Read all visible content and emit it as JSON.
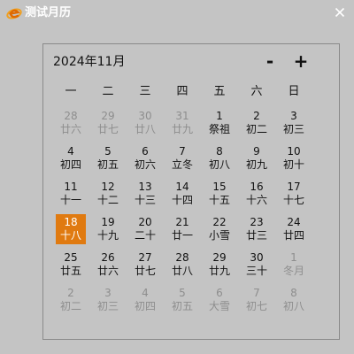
{
  "window": {
    "title": "测试月历",
    "close_icon": "close-icon",
    "logo_icon": "app-logo-icon"
  },
  "calendar": {
    "month_label": "2024年11月",
    "prev_label": "-",
    "next_label": "+",
    "weekdays": [
      "一",
      "二",
      "三",
      "四",
      "五",
      "六",
      "日"
    ],
    "selected_color": "#e07a10",
    "weeks": [
      [
        {
          "day": "28",
          "lunar": "廿六",
          "current": false
        },
        {
          "day": "29",
          "lunar": "廿七",
          "current": false
        },
        {
          "day": "30",
          "lunar": "廿八",
          "current": false
        },
        {
          "day": "31",
          "lunar": "廿九",
          "current": false
        },
        {
          "day": "1",
          "lunar": "祭祖",
          "current": true
        },
        {
          "day": "2",
          "lunar": "初二",
          "current": true
        },
        {
          "day": "3",
          "lunar": "初三",
          "current": true
        }
      ],
      [
        {
          "day": "4",
          "lunar": "初四",
          "current": true
        },
        {
          "day": "5",
          "lunar": "初五",
          "current": true
        },
        {
          "day": "6",
          "lunar": "初六",
          "current": true
        },
        {
          "day": "7",
          "lunar": "立冬",
          "current": true
        },
        {
          "day": "8",
          "lunar": "初八",
          "current": true
        },
        {
          "day": "9",
          "lunar": "初九",
          "current": true
        },
        {
          "day": "10",
          "lunar": "初十",
          "current": true
        }
      ],
      [
        {
          "day": "11",
          "lunar": "十一",
          "current": true
        },
        {
          "day": "12",
          "lunar": "十二",
          "current": true
        },
        {
          "day": "13",
          "lunar": "十三",
          "current": true
        },
        {
          "day": "14",
          "lunar": "十四",
          "current": true
        },
        {
          "day": "15",
          "lunar": "十五",
          "current": true
        },
        {
          "day": "16",
          "lunar": "十六",
          "current": true
        },
        {
          "day": "17",
          "lunar": "十七",
          "current": true
        }
      ],
      [
        {
          "day": "18",
          "lunar": "十八",
          "current": true,
          "selected": true
        },
        {
          "day": "19",
          "lunar": "十九",
          "current": true
        },
        {
          "day": "20",
          "lunar": "二十",
          "current": true
        },
        {
          "day": "21",
          "lunar": "廿一",
          "current": true
        },
        {
          "day": "22",
          "lunar": "小雪",
          "current": true
        },
        {
          "day": "23",
          "lunar": "廿三",
          "current": true
        },
        {
          "day": "24",
          "lunar": "廿四",
          "current": true
        }
      ],
      [
        {
          "day": "25",
          "lunar": "廿五",
          "current": true
        },
        {
          "day": "26",
          "lunar": "廿六",
          "current": true
        },
        {
          "day": "27",
          "lunar": "廿七",
          "current": true
        },
        {
          "day": "28",
          "lunar": "廿八",
          "current": true
        },
        {
          "day": "29",
          "lunar": "廿九",
          "current": true
        },
        {
          "day": "30",
          "lunar": "三十",
          "current": true
        },
        {
          "day": "1",
          "lunar": "冬月",
          "current": false
        }
      ],
      [
        {
          "day": "2",
          "lunar": "初二",
          "current": false
        },
        {
          "day": "3",
          "lunar": "初三",
          "current": false
        },
        {
          "day": "4",
          "lunar": "初四",
          "current": false
        },
        {
          "day": "5",
          "lunar": "初五",
          "current": false
        },
        {
          "day": "6",
          "lunar": "大雪",
          "current": false
        },
        {
          "day": "7",
          "lunar": "初七",
          "current": false
        },
        {
          "day": "8",
          "lunar": "初八",
          "current": false
        }
      ]
    ]
  }
}
